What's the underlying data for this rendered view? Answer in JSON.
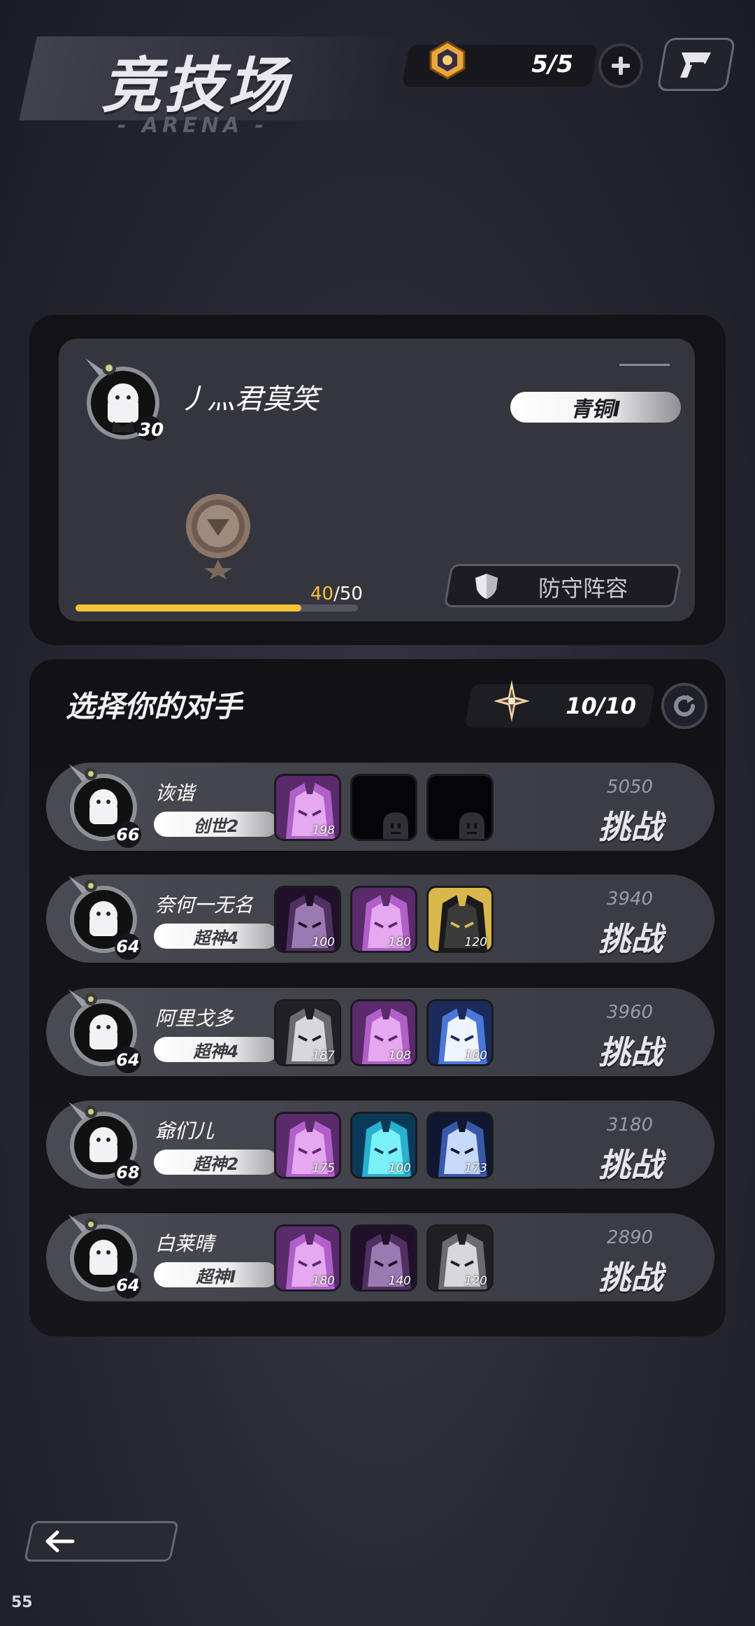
{
  "header": {
    "title": "竞技场",
    "subtitle": "- ARENA -",
    "tickets": "5/5"
  },
  "player": {
    "name": "丿灬君莫笑",
    "level": "30",
    "rank": "青铜I",
    "progress_current": "40",
    "progress_sep_total": "/50",
    "progress_fraction": 0.8,
    "defense_label": "防守阵容"
  },
  "opponents_panel": {
    "title": "选择你的对手",
    "refresh_count": "10/10",
    "challenge_label": "挑战"
  },
  "opponents": [
    {
      "name": "诙谐",
      "level": "66",
      "rank": "创世2",
      "power": "5050",
      "heroes": [
        {
          "type": "pink",
          "lvl": "198"
        },
        {
          "type": "empty",
          "lvl": ""
        },
        {
          "type": "empty",
          "lvl": ""
        }
      ]
    },
    {
      "name": "奈何一无名",
      "level": "64",
      "rank": "超神4",
      "power": "3940",
      "heroes": [
        {
          "type": "darkpurple",
          "lvl": "100"
        },
        {
          "type": "pink",
          "lvl": "180"
        },
        {
          "type": "blackgold",
          "lvl": "120"
        }
      ]
    },
    {
      "name": "阿里戈多",
      "level": "64",
      "rank": "超神4",
      "power": "3960",
      "heroes": [
        {
          "type": "grey",
          "lvl": "187"
        },
        {
          "type": "pink",
          "lvl": "108"
        },
        {
          "type": "bluewhite",
          "lvl": "100"
        }
      ]
    },
    {
      "name": "爺们儿",
      "level": "68",
      "rank": "超神2",
      "power": "3180",
      "heroes": [
        {
          "type": "pink",
          "lvl": "175"
        },
        {
          "type": "cyan",
          "lvl": "100"
        },
        {
          "type": "bluedark",
          "lvl": "173"
        }
      ]
    },
    {
      "name": "白莱晴",
      "level": "64",
      "rank": "超神I",
      "power": "2890",
      "heroes": [
        {
          "type": "pink",
          "lvl": "180"
        },
        {
          "type": "darkpurple",
          "lvl": "140"
        },
        {
          "type": "grey",
          "lvl": "120"
        }
      ]
    }
  ],
  "footer": {
    "fps": "55"
  },
  "colors": {
    "accent": "#f5c23a",
    "panel": "#121217",
    "row": "#45454d"
  }
}
